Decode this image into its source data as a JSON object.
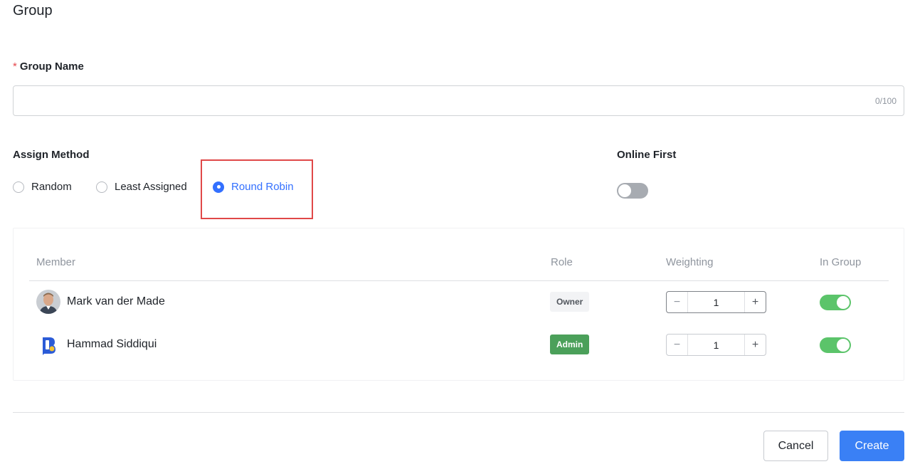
{
  "page": {
    "title": "Group"
  },
  "group_name": {
    "label": "Group Name",
    "required_mark": "*",
    "value": "",
    "placeholder": "",
    "counter": "0/100"
  },
  "assign_method": {
    "label": "Assign Method",
    "options": [
      {
        "label": "Random",
        "selected": false
      },
      {
        "label": "Least Assigned",
        "selected": false
      },
      {
        "label": "Round Robin",
        "selected": true
      }
    ]
  },
  "online_first": {
    "label": "Online First",
    "enabled": false
  },
  "members_table": {
    "headers": {
      "member": "Member",
      "role": "Role",
      "weighting": "Weighting",
      "in_group": "In Group"
    },
    "rows": [
      {
        "name": "Mark van der Made",
        "role": "Owner",
        "weighting": "1",
        "in_group": true,
        "avatar": "person-photo"
      },
      {
        "name": "Hammad Siddiqui",
        "role": "Admin",
        "weighting": "1",
        "in_group": true,
        "avatar": "brand-logo"
      }
    ]
  },
  "stepper": {
    "minus": "−",
    "plus": "+"
  },
  "footer": {
    "cancel_label": "Cancel",
    "create_label": "Create"
  },
  "colors": {
    "accent": "#3370ff",
    "create_button": "#3a80f5",
    "toggle_on": "#5bc46a",
    "toggle_off": "#a7abb1",
    "admin_badge": "#4ba05a",
    "highlight": "#e04848"
  }
}
